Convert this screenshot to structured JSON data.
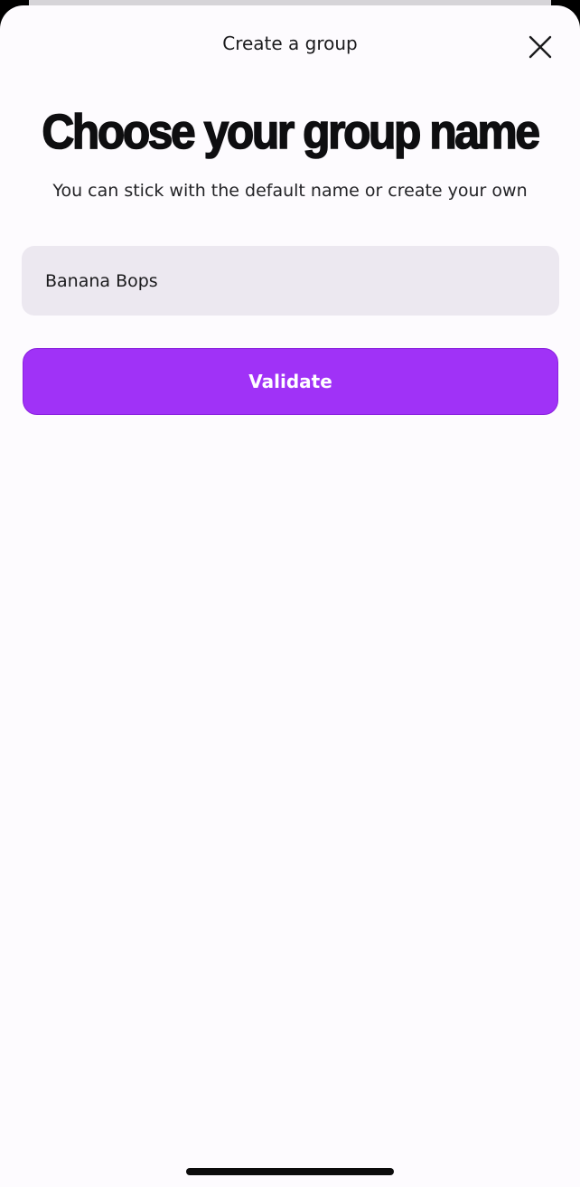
{
  "header": {
    "title": "Create a group",
    "close_icon": "close-icon"
  },
  "content": {
    "headline": "Choose your group name",
    "subtitle": "You can stick with the default name or create your own"
  },
  "group_name_field": {
    "value": "Banana Bops"
  },
  "actions": {
    "validate_label": "Validate"
  },
  "colors": {
    "accent": "#a032f7",
    "field_background": "#ece8f0",
    "sheet_background": "#fdfbfe",
    "text_primary": "#0e0e10"
  }
}
